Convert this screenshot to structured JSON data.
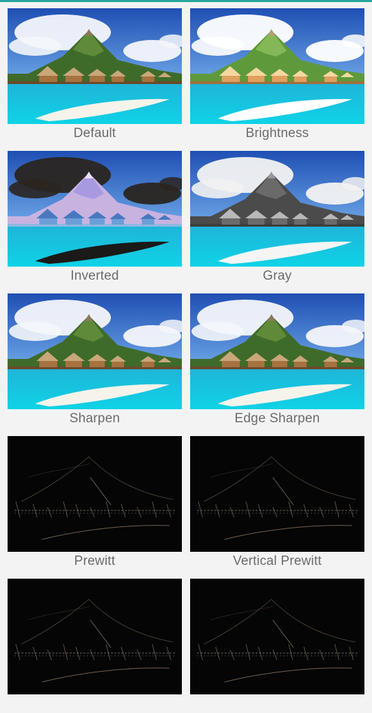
{
  "filters": [
    {
      "label": "Default",
      "style": "default"
    },
    {
      "label": "Brightness",
      "style": "brightness"
    },
    {
      "label": "Inverted",
      "style": "inverted"
    },
    {
      "label": "Gray",
      "style": "gray"
    },
    {
      "label": "Sharpen",
      "style": "default"
    },
    {
      "label": "Edge Sharpen",
      "style": "default"
    },
    {
      "label": "Prewitt",
      "style": "edge"
    },
    {
      "label": "Vertical Prewitt",
      "style": "edge"
    },
    {
      "label": "",
      "style": "edge"
    },
    {
      "label": "",
      "style": "edge"
    }
  ],
  "colors": {
    "accent": "#26a69a",
    "caption": "#6b6b6b",
    "background": "#f3f3f3"
  }
}
